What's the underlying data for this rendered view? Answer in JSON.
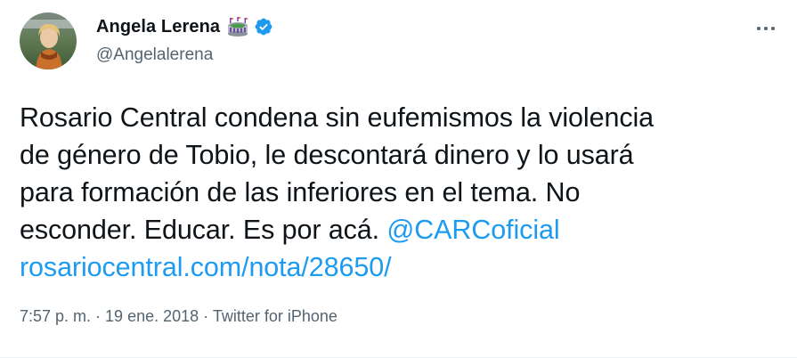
{
  "author": {
    "display_name": "Angela Lerena",
    "handle": "@Angelalerena",
    "badge_icon": "stadium-icon",
    "verified_icon": "verified-badge-icon",
    "verified_color": "#1d9bf0"
  },
  "menu": {
    "icon": "more-icon"
  },
  "tweet": {
    "text_lines": [
      "Rosario Central condena sin eufemismos la violencia",
      "de género de Tobio, le descontará dinero y lo usará",
      "para formación de las inferiores en el tema. No",
      "esconder. Educar. Es por acá. "
    ],
    "mention": "@CARCoficial",
    "link": "rosariocentral.com/nota/28650/",
    "link_color": "#1d9bf0"
  },
  "meta": {
    "time": "7:57 p. m.",
    "separator": " · ",
    "date": "19 ene. 2018",
    "source": "Twitter for iPhone"
  }
}
